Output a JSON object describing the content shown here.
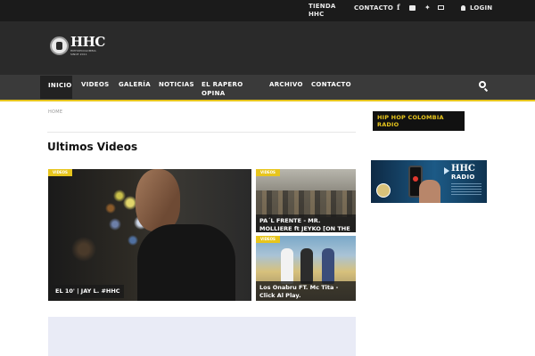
{
  "topbar": {
    "tienda": "TIENDA HHC",
    "contacto": "CONTACTO",
    "icons": [
      "facebook-icon",
      "youtube-icon",
      "twitter-icon",
      "email-icon",
      "user-icon"
    ],
    "login": "LOGIN"
  },
  "header": {
    "logo_mark": "HHC",
    "logo_sub": "HIPHOPCOLOMBIA SINCE 2011"
  },
  "nav": {
    "items": [
      "INICIO",
      "VIDEOS",
      "GALERÍA",
      "NOTICIAS",
      "EL RAPERO OPINA",
      "ARCHIVO",
      "CONTACTO"
    ],
    "active_index": 0,
    "accent_color": "#e7c51d"
  },
  "main": {
    "breadcrumb": "HOME",
    "section_title": "Ultimos Videos",
    "cards": [
      {
        "tag": "VIDEOS",
        "caption": "EL 10' | JAY L. #HHC"
      },
      {
        "tag": "VIDEOS",
        "caption": "PA´L FRENTE - MR. MOLLIERE ft JEYKO [ON THE TRACK]"
      },
      {
        "tag": "VIDEOS",
        "caption": "Los Onabru FT. Mc Tita - Click Al Play."
      }
    ]
  },
  "sidebar": {
    "title": "HIP HOP COLOMBIA RADIO",
    "banner_brand": "HHC",
    "banner_sub": "RADIO"
  }
}
